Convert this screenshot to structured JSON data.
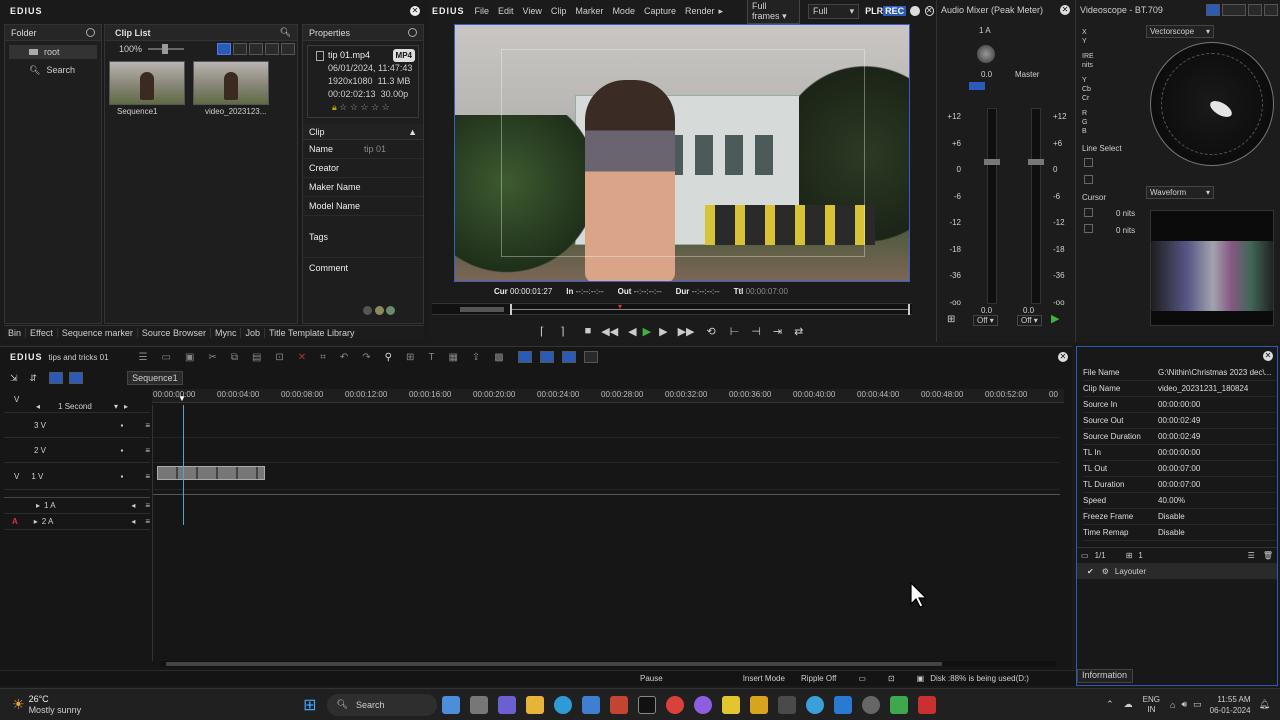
{
  "app": {
    "title": "EDIUS"
  },
  "folder": {
    "title": "Folder",
    "items": [
      {
        "label": "root"
      },
      {
        "label": "Search"
      }
    ]
  },
  "cliplist": {
    "title": "Clip List",
    "zoom": "100%",
    "clips": [
      {
        "label": "Sequence1"
      },
      {
        "label": "video_2023123..."
      }
    ]
  },
  "properties": {
    "title": "Properties",
    "file": "tip 01.mp4",
    "badge": "MP4",
    "date": "06/01/2024, 11:47:43",
    "res": "1920x1080",
    "size": "11.3 MB",
    "dur": "00:02:02:13",
    "fps": "30.00p",
    "section": "Clip",
    "fields": [
      {
        "label": "Name",
        "value": "tip 01"
      },
      {
        "label": "Creator",
        "value": ""
      },
      {
        "label": "Maker Name",
        "value": ""
      },
      {
        "label": "Model Name",
        "value": ""
      },
      {
        "label": "Tags",
        "value": ""
      },
      {
        "label": "Comment",
        "value": ""
      }
    ]
  },
  "bottom_tabs": [
    "Bin",
    "Effect",
    "Sequence marker",
    "Source Browser",
    "Mync",
    "Job",
    "Title Template Library"
  ],
  "player": {
    "app": "EDIUS",
    "menu": [
      "File",
      "Edit",
      "View",
      "Clip",
      "Marker",
      "Mode",
      "Capture",
      "Render"
    ],
    "frames": "Full frames",
    "full": "Full",
    "plr": "PLR",
    "rec": "REC",
    "cur_label": "Cur",
    "cur": "00:00:01:27",
    "in_label": "In",
    "in": "--:--:--:--",
    "out_label": "Out",
    "out": "--:--:--:--",
    "dur_label": "Dur",
    "dur": "--:--:--:--",
    "ttl_label": "Ttl",
    "ttl": "00:00:07:00"
  },
  "mixer": {
    "title": "Audio Mixer (Peak Meter)",
    "channel": "1 A",
    "master": "Master",
    "off1": "Off",
    "off2": "Off",
    "level1": "0.0",
    "level2": "0.0",
    "scale": [
      "+12",
      "+6",
      "0",
      "-6",
      "-12",
      "-18",
      "-36",
      "-oo"
    ]
  },
  "scope": {
    "title": "Videoscope - BT.709",
    "vectorscope": "Vectorscope",
    "waveform": "Waveform",
    "labels": [
      "X",
      "Y",
      "IRE",
      "nits",
      "Y",
      "Cb",
      "Cr",
      "R",
      "G",
      "B"
    ],
    "line_select": "Line Select",
    "cursor": "Cursor",
    "nits1": "0 nits",
    "nits2": "0 nits"
  },
  "timeline": {
    "app": "EDIUS",
    "project": "tips and tricks 01",
    "sequence": "Sequence1",
    "scale": "1 Second",
    "ticks": [
      "00:00:00:00",
      "00:00:04:00",
      "00:00:08:00",
      "00:00:12:00",
      "00:00:16:00",
      "00:00:20:00",
      "00:00:24:00",
      "00:00:28:00",
      "00:00:32:00",
      "00:00:36:00",
      "00:00:40:00",
      "00:00:44:00",
      "00:00:48:00",
      "00:00:52:00",
      "00"
    ],
    "tracks": [
      "3 V",
      "2 V",
      "1 V",
      "1 A",
      "2 A"
    ],
    "v_label": "V",
    "a_label": "A"
  },
  "info": {
    "rows": [
      {
        "k": "File Name",
        "v": "G:\\Nithin\\Christmas 2023 dec\\..."
      },
      {
        "k": "Clip Name",
        "v": "video_20231231_180824"
      },
      {
        "k": "Source In",
        "v": "00:00:00:00"
      },
      {
        "k": "Source Out",
        "v": "00:00:02:49"
      },
      {
        "k": "Source Duration",
        "v": "00:00:02:49"
      },
      {
        "k": "TL In",
        "v": "00:00:00:00"
      },
      {
        "k": "TL Out",
        "v": "00:00:07:00"
      },
      {
        "k": "TL Duration",
        "v": "00:00:07:00"
      },
      {
        "k": "Speed",
        "v": "40.00%"
      },
      {
        "k": "Freeze Frame",
        "v": "Disable"
      },
      {
        "k": "Time Remap",
        "v": "Disable"
      }
    ],
    "layer_count": "1/1",
    "layer_count2": "1",
    "layouter": "Layouter",
    "tab": "Information"
  },
  "status": {
    "pause": "Pause",
    "insert": "Insert Mode",
    "ripple": "Ripple Off",
    "disk": "Disk :88% is being used(D:)"
  },
  "taskbar": {
    "temp": "26°C",
    "weather": "Mostly sunny",
    "search": "Search",
    "lang1": "ENG",
    "lang2": "IN",
    "time": "11:55 AM",
    "date": "06-01-2024"
  }
}
